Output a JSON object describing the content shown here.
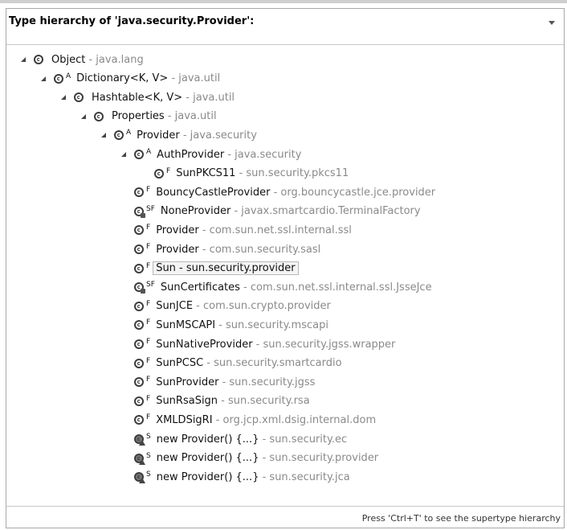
{
  "header": {
    "title": "Type hierarchy of 'java.security.Provider':"
  },
  "tree": [
    {
      "id": "object",
      "name": "Object",
      "pkg": " - java.lang",
      "mod": "",
      "icon": "class-icon",
      "expanded": true
    },
    {
      "id": "dictionary",
      "name": "Dictionary<K, V>",
      "pkg": " - java.util",
      "mod": "A",
      "icon": "class-icon",
      "expanded": true
    },
    {
      "id": "hashtable",
      "name": "Hashtable<K, V>",
      "pkg": " - java.util",
      "mod": "",
      "icon": "class-icon",
      "expanded": true
    },
    {
      "id": "properties",
      "name": "Properties",
      "pkg": " - java.util",
      "mod": "",
      "icon": "class-icon",
      "expanded": true
    },
    {
      "id": "provider-root",
      "name": "Provider",
      "pkg": " - java.security",
      "mod": "A",
      "icon": "class-icon",
      "expanded": true
    },
    {
      "id": "authprovider",
      "name": "AuthProvider",
      "pkg": " - java.security",
      "mod": "A",
      "icon": "class-icon",
      "expanded": true
    },
    {
      "id": "sunpkcs11",
      "name": "SunPKCS11",
      "pkg": " - sun.security.pkcs11",
      "mod": "F",
      "icon": "class-icon"
    },
    {
      "id": "bouncycastle",
      "name": "BouncyCastleProvider",
      "pkg": " - org.bouncycastle.jce.provider",
      "mod": "F",
      "icon": "class-icon"
    },
    {
      "id": "noneprovider",
      "name": "NoneProvider",
      "pkg": " - javax.smartcardio.TerminalFactory",
      "mod": "SF",
      "icon": "class-icon"
    },
    {
      "id": "provider-ssl",
      "name": "Provider",
      "pkg": " - com.sun.net.ssl.internal.ssl",
      "mod": "F",
      "icon": "class-icon"
    },
    {
      "id": "provider-sasl",
      "name": "Provider",
      "pkg": " - com.sun.security.sasl",
      "mod": "F",
      "icon": "class-icon"
    },
    {
      "id": "sun",
      "name": "Sun",
      "pkg": " - sun.security.provider",
      "mod": "F",
      "icon": "class-icon"
    },
    {
      "id": "suncertificates",
      "name": "SunCertificates",
      "pkg": " - com.sun.net.ssl.internal.ssl.JsseJce",
      "mod": "SF",
      "icon": "class-icon"
    },
    {
      "id": "sunjce",
      "name": "SunJCE",
      "pkg": " - com.sun.crypto.provider",
      "mod": "F",
      "icon": "class-icon"
    },
    {
      "id": "sunmscapi",
      "name": "SunMSCAPI",
      "pkg": " - sun.security.mscapi",
      "mod": "F",
      "icon": "class-icon"
    },
    {
      "id": "sunnativeprovider",
      "name": "SunNativeProvider",
      "pkg": " - sun.security.jgss.wrapper",
      "mod": "F",
      "icon": "class-icon"
    },
    {
      "id": "sunpcsc",
      "name": "SunPCSC",
      "pkg": " - sun.security.smartcardio",
      "mod": "F",
      "icon": "class-icon"
    },
    {
      "id": "sunprovider",
      "name": "SunProvider",
      "pkg": " - sun.security.jgss",
      "mod": "F",
      "icon": "class-icon"
    },
    {
      "id": "sunrsasign",
      "name": "SunRsaSign",
      "pkg": " - sun.security.rsa",
      "mod": "F",
      "icon": "class-icon"
    },
    {
      "id": "xmldsigri",
      "name": "XMLDSigRI",
      "pkg": " - org.jcp.xml.dsig.internal.dom",
      "mod": "F",
      "icon": "class-icon"
    },
    {
      "id": "anon-ec",
      "name": "new Provider() {...}",
      "pkg": " - sun.security.ec",
      "mod": "S",
      "icon": "anonymous-class-icon"
    },
    {
      "id": "anon-provider",
      "name": "new Provider() {...}",
      "pkg": " - sun.security.provider",
      "mod": "S",
      "icon": "anonymous-class-icon"
    },
    {
      "id": "anon-jca",
      "name": "new Provider() {...}",
      "pkg": " - sun.security.jca",
      "mod": "S",
      "icon": "anonymous-class-icon"
    }
  ],
  "selected": "sun",
  "status": {
    "text": "Press 'Ctrl+T' to see the supertype hierarchy"
  }
}
